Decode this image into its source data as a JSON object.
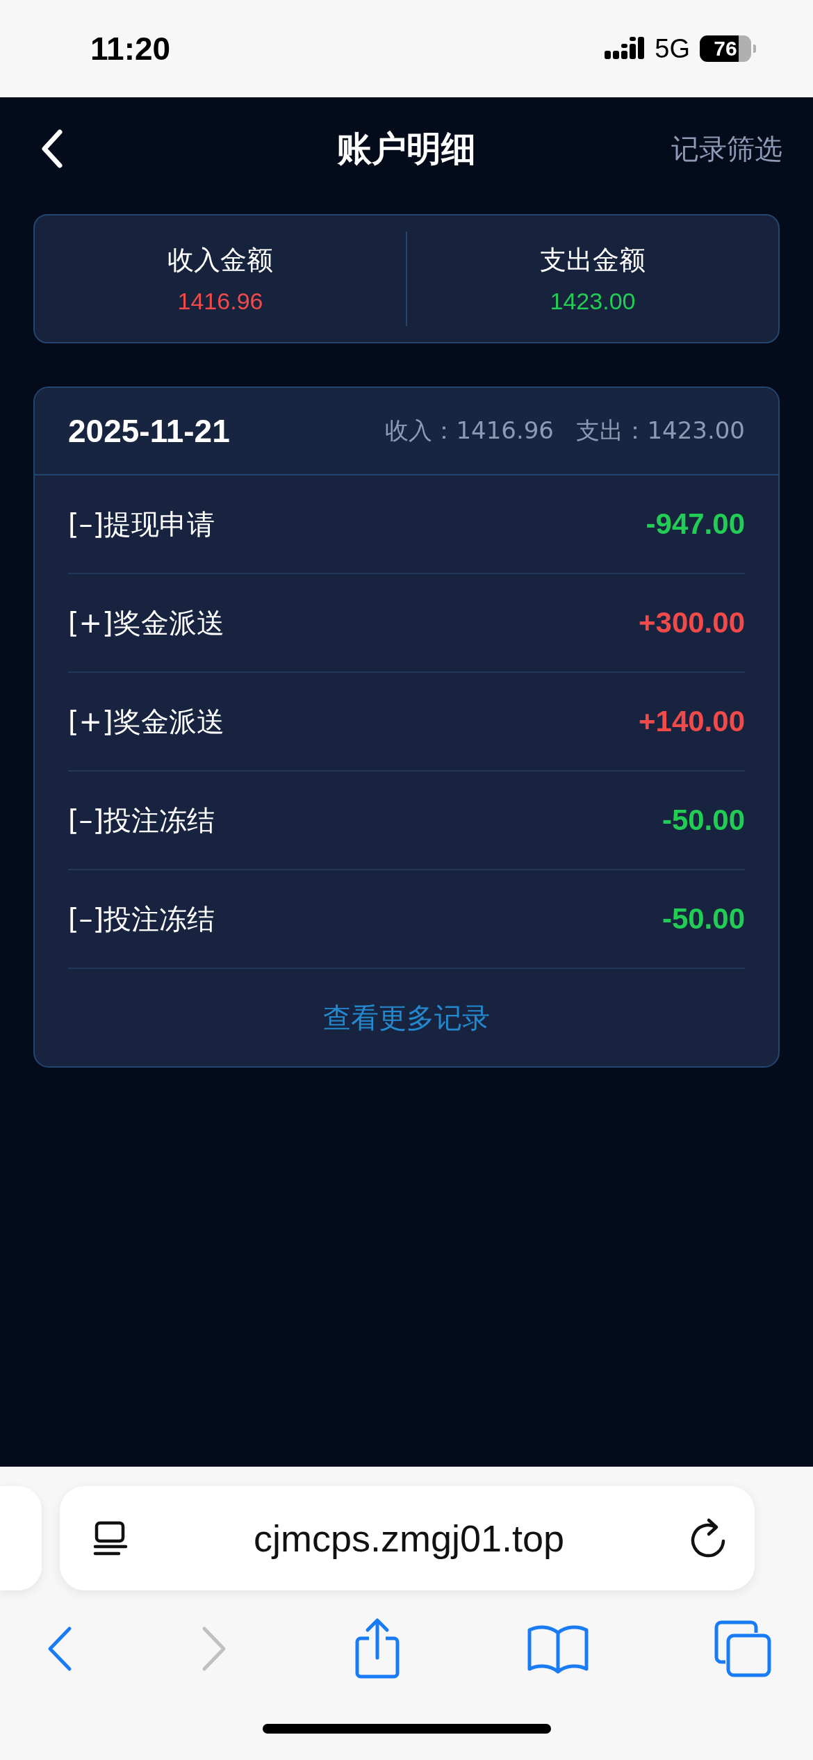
{
  "status_bar": {
    "time": "11:20",
    "network": "5G",
    "battery": "76"
  },
  "header": {
    "title": "账户明细",
    "action": "记录筛选"
  },
  "summary": [
    {
      "label": "收入金额",
      "value": "1416.96",
      "kind": "income"
    },
    {
      "label": "支出金额",
      "value": "1423.00",
      "kind": "expense"
    }
  ],
  "day": {
    "date": "2025-11-21",
    "income_label": "收入：",
    "income": "1416.96",
    "expense_label": "支出：",
    "expense": "1423.00",
    "records": [
      {
        "title": "[–]提现申请",
        "amount": "-947.00",
        "kind": "expense"
      },
      {
        "title": "[+]奖金派送",
        "amount": "+300.00",
        "kind": "income"
      },
      {
        "title": "[+]奖金派送",
        "amount": "+140.00",
        "kind": "income"
      },
      {
        "title": "[–]投注冻结",
        "amount": "-50.00",
        "kind": "expense"
      },
      {
        "title": "[–]投注冻结",
        "amount": "-50.00",
        "kind": "expense"
      }
    ],
    "more": "查看更多记录"
  },
  "browser": {
    "url": "cjmcps.zmgj01.top",
    "back_disabled": false,
    "forward_disabled": true
  }
}
